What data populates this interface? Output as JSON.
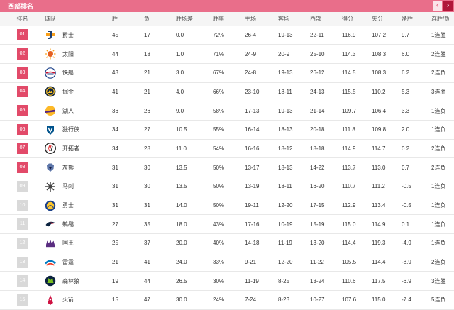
{
  "header": {
    "title": "西部排名",
    "prev_icon": "chevron-left-icon",
    "next_icon": "chevron-right-icon",
    "prev_glyph": "‹",
    "next_glyph": "›"
  },
  "columns": [
    "排名",
    "球队",
    "胜",
    "负",
    "胜场差",
    "胜率",
    "主场",
    "客场",
    "西部",
    "得分",
    "失分",
    "净胜",
    "连胜/负"
  ],
  "colors": {
    "header_bar": "#e96e8a",
    "playoff_rank": "#e24a69",
    "other_rank": "#d9d9d9",
    "next_button": "#b0173a"
  },
  "rows": [
    {
      "rank": "01",
      "logo": "jazz-logo-icon",
      "team": "爵士",
      "w": "45",
      "l": "17",
      "gb": "0.0",
      "pct": "72%",
      "home": "26-4",
      "away": "19-13",
      "conf": "22-11",
      "pf": "116.9",
      "pa": "107.2",
      "net": "9.7",
      "streak": "1连胜",
      "playoff": true
    },
    {
      "rank": "02",
      "logo": "suns-logo-icon",
      "team": "太阳",
      "w": "44",
      "l": "18",
      "gb": "1.0",
      "pct": "71%",
      "home": "24-9",
      "away": "20-9",
      "conf": "25-10",
      "pf": "114.3",
      "pa": "108.3",
      "net": "6.0",
      "streak": "2连胜",
      "playoff": true
    },
    {
      "rank": "03",
      "logo": "clippers-logo-icon",
      "team": "快船",
      "w": "43",
      "l": "21",
      "gb": "3.0",
      "pct": "67%",
      "home": "24-8",
      "away": "19-13",
      "conf": "26-12",
      "pf": "114.5",
      "pa": "108.3",
      "net": "6.2",
      "streak": "2连负",
      "playoff": true
    },
    {
      "rank": "04",
      "logo": "nuggets-logo-icon",
      "team": "掘金",
      "w": "41",
      "l": "21",
      "gb": "4.0",
      "pct": "66%",
      "home": "23-10",
      "away": "18-11",
      "conf": "24-13",
      "pf": "115.5",
      "pa": "110.2",
      "net": "5.3",
      "streak": "3连胜",
      "playoff": true
    },
    {
      "rank": "05",
      "logo": "lakers-logo-icon",
      "team": "湖人",
      "w": "36",
      "l": "26",
      "gb": "9.0",
      "pct": "58%",
      "home": "17-13",
      "away": "19-13",
      "conf": "21-14",
      "pf": "109.7",
      "pa": "106.4",
      "net": "3.3",
      "streak": "1连负",
      "playoff": true
    },
    {
      "rank": "06",
      "logo": "mavericks-logo-icon",
      "team": "独行侠",
      "w": "34",
      "l": "27",
      "gb": "10.5",
      "pct": "55%",
      "home": "16-14",
      "away": "18-13",
      "conf": "20-18",
      "pf": "111.8",
      "pa": "109.8",
      "net": "2.0",
      "streak": "1连负",
      "playoff": true
    },
    {
      "rank": "07",
      "logo": "blazers-logo-icon",
      "team": "开拓者",
      "w": "34",
      "l": "28",
      "gb": "11.0",
      "pct": "54%",
      "home": "16-16",
      "away": "18-12",
      "conf": "18-18",
      "pf": "114.9",
      "pa": "114.7",
      "net": "0.2",
      "streak": "2连负",
      "playoff": true
    },
    {
      "rank": "08",
      "logo": "grizzlies-logo-icon",
      "team": "灰熊",
      "w": "31",
      "l": "30",
      "gb": "13.5",
      "pct": "50%",
      "home": "13-17",
      "away": "18-13",
      "conf": "14-22",
      "pf": "113.7",
      "pa": "113.0",
      "net": "0.7",
      "streak": "2连负",
      "playoff": true
    },
    {
      "rank": "09",
      "logo": "spurs-logo-icon",
      "team": "马刺",
      "w": "31",
      "l": "30",
      "gb": "13.5",
      "pct": "50%",
      "home": "13-19",
      "away": "18-11",
      "conf": "16-20",
      "pf": "110.7",
      "pa": "111.2",
      "net": "-0.5",
      "streak": "1连负",
      "playoff": false
    },
    {
      "rank": "10",
      "logo": "warriors-logo-icon",
      "team": "勇士",
      "w": "31",
      "l": "31",
      "gb": "14.0",
      "pct": "50%",
      "home": "19-11",
      "away": "12-20",
      "conf": "17-15",
      "pf": "112.9",
      "pa": "113.4",
      "net": "-0.5",
      "streak": "1连负",
      "playoff": false
    },
    {
      "rank": "11",
      "logo": "pelicans-logo-icon",
      "team": "鹈鹕",
      "w": "27",
      "l": "35",
      "gb": "18.0",
      "pct": "43%",
      "home": "17-16",
      "away": "10-19",
      "conf": "15-19",
      "pf": "115.0",
      "pa": "114.9",
      "net": "0.1",
      "streak": "1连负",
      "playoff": false
    },
    {
      "rank": "12",
      "logo": "kings-logo-icon",
      "team": "国王",
      "w": "25",
      "l": "37",
      "gb": "20.0",
      "pct": "40%",
      "home": "14-18",
      "away": "11-19",
      "conf": "13-20",
      "pf": "114.4",
      "pa": "119.3",
      "net": "-4.9",
      "streak": "1连负",
      "playoff": false
    },
    {
      "rank": "13",
      "logo": "thunder-logo-icon",
      "team": "雷霆",
      "w": "21",
      "l": "41",
      "gb": "24.0",
      "pct": "33%",
      "home": "9-21",
      "away": "12-20",
      "conf": "11-22",
      "pf": "105.5",
      "pa": "114.4",
      "net": "-8.9",
      "streak": "2连负",
      "playoff": false
    },
    {
      "rank": "14",
      "logo": "timberwolves-logo-icon",
      "team": "森林狼",
      "w": "19",
      "l": "44",
      "gb": "26.5",
      "pct": "30%",
      "home": "11-19",
      "away": "8-25",
      "conf": "13-24",
      "pf": "110.6",
      "pa": "117.5",
      "net": "-6.9",
      "streak": "3连胜",
      "playoff": false
    },
    {
      "rank": "15",
      "logo": "rockets-logo-icon",
      "team": "火箭",
      "w": "15",
      "l": "47",
      "gb": "30.0",
      "pct": "24%",
      "home": "7-24",
      "away": "8-23",
      "conf": "10-27",
      "pf": "107.6",
      "pa": "115.0",
      "net": "-7.4",
      "streak": "5连负",
      "playoff": false
    }
  ]
}
